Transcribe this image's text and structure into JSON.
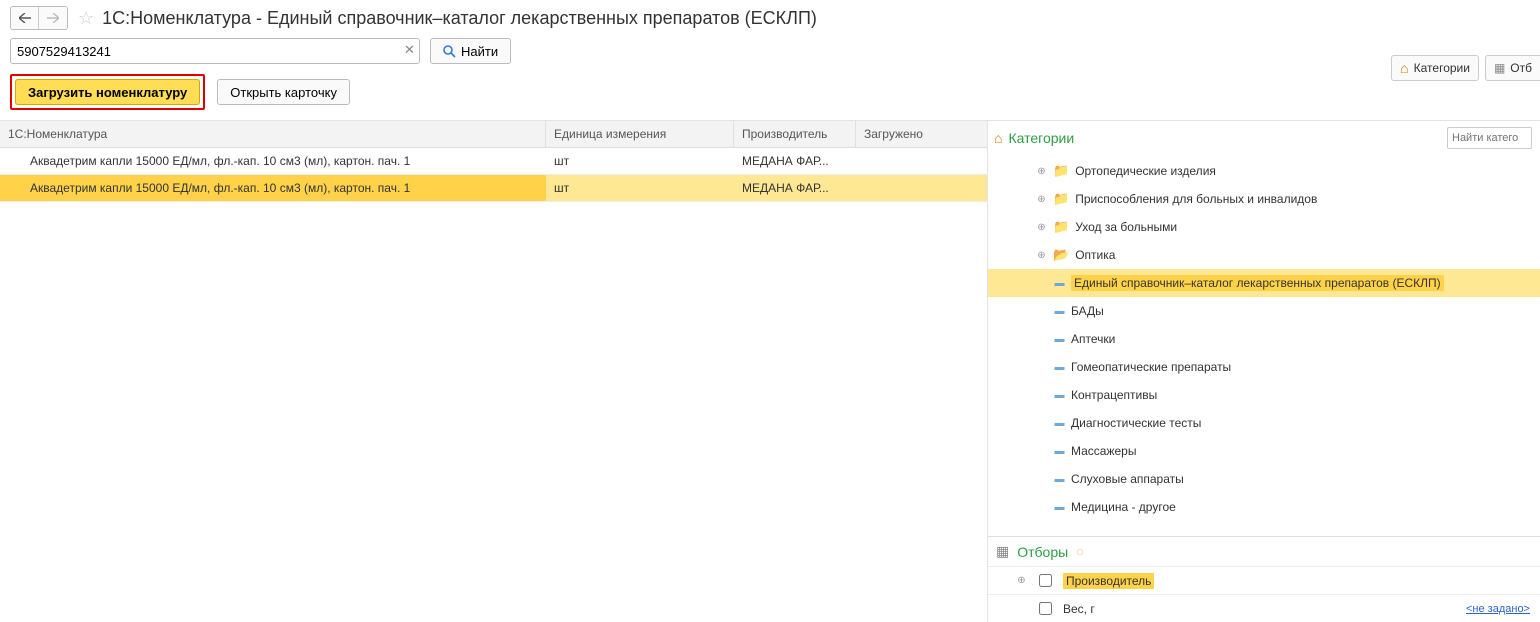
{
  "header": {
    "title": "1С:Номенклатура - Единый справочник–каталог лекарственных препаратов (ЕСКЛП)"
  },
  "search": {
    "value": "5907529413241",
    "find_label": "Найти"
  },
  "toolbar": {
    "load_label": "Загрузить номенклатуру",
    "open_card_label": "Открыть карточку"
  },
  "topchips": {
    "categories_label": "Категории",
    "filters_label": "Отб"
  },
  "table": {
    "headers": {
      "name": "1С:Номенклатура",
      "unit": "Единица измерения",
      "mfr": "Производитель",
      "loaded": "Загружено"
    },
    "rows": [
      {
        "name": "Аквадетрим капли 15000 ЕД/мл, фл.-кап. 10 см3 (мл), картон. пач. 1",
        "unit": "шт",
        "mfr": "МЕДАНА ФАР...",
        "loaded": "",
        "selected": false
      },
      {
        "name": "Аквадетрим капли 15000 ЕД/мл, фл.-кап. 10 см3 (мл), картон. пач. 1",
        "unit": "шт",
        "mfr": "МЕДАНА ФАР...",
        "loaded": "",
        "selected": true
      }
    ]
  },
  "categories": {
    "title": "Категории",
    "search_placeholder": "Найти катего",
    "items": [
      {
        "type": "folder",
        "label": "Ортопедические изделия",
        "level": 1
      },
      {
        "type": "folder",
        "label": "Приспособления для больных и инвалидов",
        "level": 1
      },
      {
        "type": "folder",
        "label": "Уход за больными",
        "level": 1
      },
      {
        "type": "folder-open",
        "label": "Оптика",
        "level": 1
      },
      {
        "type": "leaf",
        "label": "Единый справочник–каталог лекарственных препаратов (ЕСКЛП)",
        "level": 2,
        "selected": true
      },
      {
        "type": "leaf",
        "label": "БАДы",
        "level": 2
      },
      {
        "type": "leaf",
        "label": "Аптечки",
        "level": 2
      },
      {
        "type": "leaf",
        "label": "Гомеопатические препараты",
        "level": 2
      },
      {
        "type": "leaf",
        "label": "Контрацептивы",
        "level": 2
      },
      {
        "type": "leaf",
        "label": "Диагностические тесты",
        "level": 2
      },
      {
        "type": "leaf",
        "label": "Массажеры",
        "level": 2
      },
      {
        "type": "leaf",
        "label": "Слуховые аппараты",
        "level": 2
      },
      {
        "type": "leaf",
        "label": "Медицина - другое",
        "level": 2
      }
    ]
  },
  "filters": {
    "title": "Отборы",
    "rows": [
      {
        "label": "Производитель",
        "selected": true,
        "expandable": true
      },
      {
        "label": "Вес, г",
        "notset": "<не задано>",
        "expandable": false
      }
    ]
  }
}
